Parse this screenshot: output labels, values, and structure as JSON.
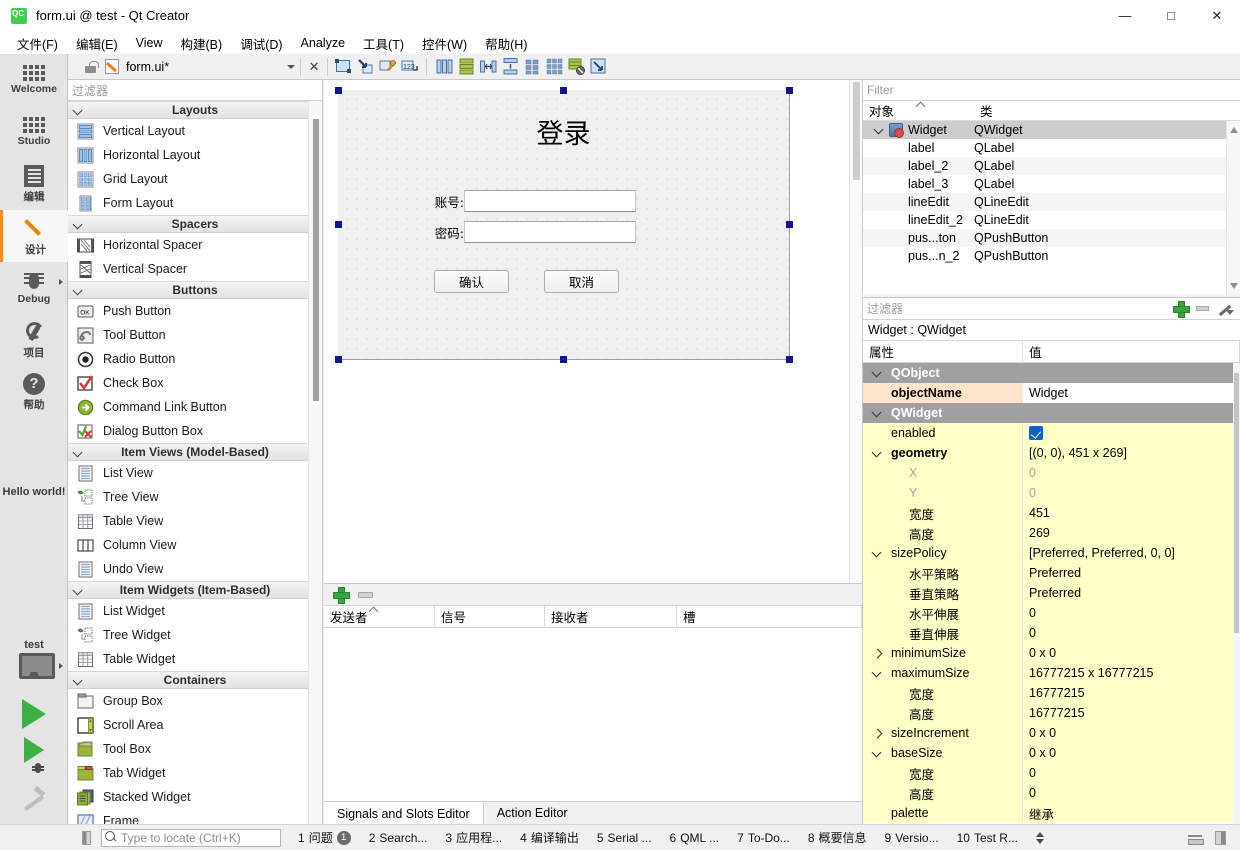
{
  "window": {
    "title": "form.ui @ test - Qt Creator",
    "logo_label": "QC",
    "minimize": "—",
    "maximize": "□",
    "close": "✕"
  },
  "menubar": {
    "items": [
      {
        "label": "文件(F)"
      },
      {
        "label": "编辑(E)"
      },
      {
        "label": "View"
      },
      {
        "label": "构建(B)"
      },
      {
        "label": "调试(D)"
      },
      {
        "label": "Analyze"
      },
      {
        "label": "工具(T)"
      },
      {
        "label": "控件(W)"
      },
      {
        "label": "帮助(H)"
      }
    ]
  },
  "modebar": {
    "items": [
      {
        "label": "Welcome",
        "icon": "grid-icon",
        "active": false
      },
      {
        "label": "Studio",
        "icon": "grid-icon",
        "active": false
      },
      {
        "label": "编辑",
        "icon": "document-icon",
        "active": false
      },
      {
        "label": "设计",
        "icon": "pencil-icon",
        "active": true
      },
      {
        "label": "Debug",
        "icon": "bug-icon",
        "active": false
      },
      {
        "label": "项目",
        "icon": "wrench-icon",
        "active": false
      },
      {
        "label": "帮助",
        "icon": "help-icon",
        "active": false
      }
    ],
    "hello_world": "Hello world!",
    "kit_name": "test",
    "kit_icon": "monitor-icon",
    "run_icon": "run-play-icon",
    "debug_icon": "run-debug-icon",
    "build_icon": "hammer-icon"
  },
  "editor_toolbar": {
    "lock_icon": "unlocked-icon",
    "file_icon": "ui-file-icon",
    "file_name": "form.ui*",
    "dropdown_icon": "chevron-down-icon",
    "close_icon": "close-icon",
    "tools": [
      {
        "name": "edit-widgets-icon"
      },
      {
        "name": "edit-signals-slots-icon"
      },
      {
        "name": "edit-buddies-icon"
      },
      {
        "name": "edit-tab-order-icon"
      },
      {
        "name": "layout-horizontally-icon"
      },
      {
        "name": "layout-vertically-icon"
      },
      {
        "name": "layout-splitter-horizontal-icon"
      },
      {
        "name": "layout-splitter-vertical-icon"
      },
      {
        "name": "layout-form-icon"
      },
      {
        "name": "layout-grid-icon"
      },
      {
        "name": "break-layout-icon"
      },
      {
        "name": "adjust-size-icon"
      }
    ]
  },
  "widget_box": {
    "filter_placeholder": "过滤器",
    "groups": [
      {
        "title": "Layouts",
        "items": [
          {
            "label": "Vertical Layout",
            "icon": "vertical-layout-icon"
          },
          {
            "label": "Horizontal Layout",
            "icon": "horizontal-layout-icon"
          },
          {
            "label": "Grid Layout",
            "icon": "grid-layout-icon"
          },
          {
            "label": "Form Layout",
            "icon": "form-layout-icon"
          }
        ]
      },
      {
        "title": "Spacers",
        "items": [
          {
            "label": "Horizontal Spacer",
            "icon": "horizontal-spacer-icon"
          },
          {
            "label": "Vertical Spacer",
            "icon": "vertical-spacer-icon"
          }
        ]
      },
      {
        "title": "Buttons",
        "items": [
          {
            "label": "Push Button",
            "icon": "push-button-icon"
          },
          {
            "label": "Tool Button",
            "icon": "tool-button-icon"
          },
          {
            "label": "Radio Button",
            "icon": "radio-button-icon"
          },
          {
            "label": "Check Box",
            "icon": "check-box-icon"
          },
          {
            "label": "Command Link Button",
            "icon": "command-link-icon"
          },
          {
            "label": "Dialog Button Box",
            "icon": "dialog-button-box-icon"
          }
        ]
      },
      {
        "title": "Item Views (Model-Based)",
        "items": [
          {
            "label": "List View",
            "icon": "list-view-icon"
          },
          {
            "label": "Tree View",
            "icon": "tree-view-icon"
          },
          {
            "label": "Table View",
            "icon": "table-view-icon"
          },
          {
            "label": "Column View",
            "icon": "column-view-icon"
          },
          {
            "label": "Undo View",
            "icon": "undo-view-icon"
          }
        ]
      },
      {
        "title": "Item Widgets (Item-Based)",
        "items": [
          {
            "label": "List Widget",
            "icon": "list-widget-icon"
          },
          {
            "label": "Tree Widget",
            "icon": "tree-widget-icon"
          },
          {
            "label": "Table Widget",
            "icon": "table-widget-icon"
          }
        ]
      },
      {
        "title": "Containers",
        "items": [
          {
            "label": "Group Box",
            "icon": "group-box-icon"
          },
          {
            "label": "Scroll Area",
            "icon": "scroll-area-icon"
          },
          {
            "label": "Tool Box",
            "icon": "tool-box-icon"
          },
          {
            "label": "Tab Widget",
            "icon": "tab-widget-icon"
          },
          {
            "label": "Stacked Widget",
            "icon": "stacked-widget-icon"
          },
          {
            "label": "Frame",
            "icon": "frame-icon"
          }
        ]
      }
    ]
  },
  "form": {
    "title": "登录",
    "fields": [
      {
        "label": "账号:",
        "value": ""
      },
      {
        "label": "密码:",
        "value": ""
      }
    ],
    "buttons": [
      {
        "label": "确认"
      },
      {
        "label": "取消"
      }
    ]
  },
  "signals_dock": {
    "add_icon": "add-icon",
    "remove_icon": "remove-icon",
    "columns": [
      "发送者",
      "信号",
      "接收者",
      "槽"
    ],
    "rows": [],
    "tabs": [
      {
        "label": "Signals and Slots Editor",
        "active": true
      },
      {
        "label": "Action Editor",
        "active": false
      }
    ]
  },
  "object_inspector": {
    "filter_placeholder": "Filter",
    "columns": [
      "对象",
      "类"
    ],
    "rows": [
      {
        "name": "Widget",
        "class": "QWidget",
        "selected": true,
        "indent": 0,
        "expandable": true
      },
      {
        "name": "label",
        "class": "QLabel",
        "selected": false,
        "indent": 1,
        "expandable": false
      },
      {
        "name": "label_2",
        "class": "QLabel",
        "selected": false,
        "indent": 1,
        "expandable": false
      },
      {
        "name": "label_3",
        "class": "QLabel",
        "selected": false,
        "indent": 1,
        "expandable": false
      },
      {
        "name": "lineEdit",
        "class": "QLineEdit",
        "selected": false,
        "indent": 1,
        "expandable": false
      },
      {
        "name": "lineEdit_2",
        "class": "QLineEdit",
        "selected": false,
        "indent": 1,
        "expandable": false
      },
      {
        "name": "pus...ton",
        "class": "QPushButton",
        "selected": false,
        "indent": 1,
        "expandable": false
      },
      {
        "name": "pus...n_2",
        "class": "QPushButton",
        "selected": false,
        "indent": 1,
        "expandable": false
      }
    ]
  },
  "property_editor": {
    "filter_placeholder": "过滤器",
    "add_icon": "add-icon",
    "remove_icon": "remove-icon",
    "configure_icon": "configure-icon",
    "object_line": "Widget : QWidget",
    "columns": [
      "属性",
      "值"
    ],
    "rows": [
      {
        "key": "QObject",
        "value": "",
        "style": "group",
        "indent": 0,
        "chevron": "expanded"
      },
      {
        "key": "objectName",
        "value": "Widget",
        "style": "peach",
        "indent": 1,
        "bold": true
      },
      {
        "key": "QWidget",
        "value": "",
        "style": "group",
        "indent": 0,
        "chevron": "expanded"
      },
      {
        "key": "enabled",
        "value": "",
        "style": "yellow",
        "indent": 1,
        "checkbox": true
      },
      {
        "key": "geometry",
        "value": "[(0, 0), 451 x 269]",
        "style": "yellow",
        "indent": 0,
        "chevron": "expanded",
        "bold": true
      },
      {
        "key": "X",
        "value": "0",
        "style": "yellow",
        "indent": 2,
        "dim": true
      },
      {
        "key": "Y",
        "value": "0",
        "style": "yellow",
        "indent": 2,
        "dim": true
      },
      {
        "key": "宽度",
        "value": "451",
        "style": "yellow",
        "indent": 2
      },
      {
        "key": "高度",
        "value": "269",
        "style": "yellow",
        "indent": 2
      },
      {
        "key": "sizePolicy",
        "value": "[Preferred, Preferred, 0, 0]",
        "style": "yellow",
        "indent": 0,
        "chevron": "expanded"
      },
      {
        "key": "水平策略",
        "value": "Preferred",
        "style": "yellow",
        "indent": 2
      },
      {
        "key": "垂直策略",
        "value": "Preferred",
        "style": "yellow",
        "indent": 2
      },
      {
        "key": "水平伸展",
        "value": "0",
        "style": "yellow",
        "indent": 2
      },
      {
        "key": "垂直伸展",
        "value": "0",
        "style": "yellow",
        "indent": 2
      },
      {
        "key": "minimumSize",
        "value": "0 x 0",
        "style": "yellow",
        "indent": 0,
        "chevron": "collapsed"
      },
      {
        "key": "maximumSize",
        "value": "16777215 x 16777215",
        "style": "yellow",
        "indent": 0,
        "chevron": "expanded"
      },
      {
        "key": "宽度",
        "value": "16777215",
        "style": "yellow",
        "indent": 2
      },
      {
        "key": "高度",
        "value": "16777215",
        "style": "yellow",
        "indent": 2
      },
      {
        "key": "sizeIncrement",
        "value": "0 x 0",
        "style": "yellow",
        "indent": 0,
        "chevron": "collapsed"
      },
      {
        "key": "baseSize",
        "value": "0 x 0",
        "style": "yellow",
        "indent": 0,
        "chevron": "expanded"
      },
      {
        "key": "宽度",
        "value": "0",
        "style": "yellow",
        "indent": 2
      },
      {
        "key": "高度",
        "value": "0",
        "style": "yellow",
        "indent": 2
      },
      {
        "key": "palette",
        "value": "继承",
        "style": "yellow",
        "indent": 1
      }
    ]
  },
  "status_bar": {
    "locator_placeholder": "Type to locate (Ctrl+K)",
    "search_icon": "search-icon",
    "panes": [
      {
        "num": "1",
        "label": "问题",
        "badge": "1"
      },
      {
        "num": "2",
        "label": "Search...",
        "badge": ""
      },
      {
        "num": "3",
        "label": "应用程...",
        "badge": ""
      },
      {
        "num": "4",
        "label": "编译输出",
        "badge": ""
      },
      {
        "num": "5",
        "label": "Serial ...",
        "badge": ""
      },
      {
        "num": "6",
        "label": "QML ...",
        "badge": ""
      },
      {
        "num": "7",
        "label": "To-Do...",
        "badge": ""
      },
      {
        "num": "8",
        "label": "概要信息",
        "badge": ""
      },
      {
        "num": "9",
        "label": "Versio...",
        "badge": ""
      },
      {
        "num": "10",
        "label": "Test R...",
        "badge": ""
      }
    ]
  }
}
